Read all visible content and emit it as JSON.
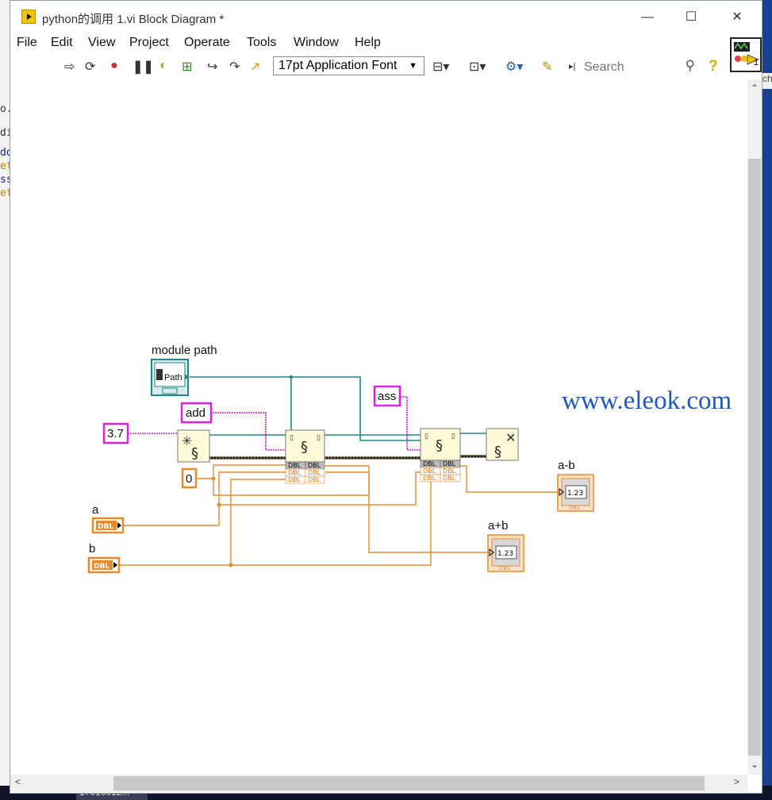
{
  "window": {
    "title": "python的调用 1.vi Block Diagram *",
    "controls": {
      "minimize": "—",
      "maximize": "☐",
      "close": "✕"
    }
  },
  "menu": [
    "File",
    "Edit",
    "View",
    "Project",
    "Operate",
    "Tools",
    "Window",
    "Help"
  ],
  "toolbar": {
    "font_select": "17pt Application Font",
    "search_placeholder": "Search",
    "help": "?"
  },
  "connector_pane": {
    "number": "1"
  },
  "diagram": {
    "module_path_label": "module path",
    "path_control_text": "Path",
    "const_version": "3.7",
    "const_add": "add",
    "const_ass": "ass",
    "const_zero": "0",
    "control_a_label": "a",
    "control_b_label": "b",
    "control_type": "DBL",
    "indicator_ab_minus_label": "a-b",
    "indicator_ab_plus_label": "a+b",
    "indicator_value": "1.23"
  },
  "left_edge_fragments": [
    "o.",
    "di",
    "dd",
    "et",
    "ss",
    "et"
  ],
  "right_edge_fragment": "ch",
  "taskbar_item": "17010012...",
  "watermark": "www.eleok.com"
}
